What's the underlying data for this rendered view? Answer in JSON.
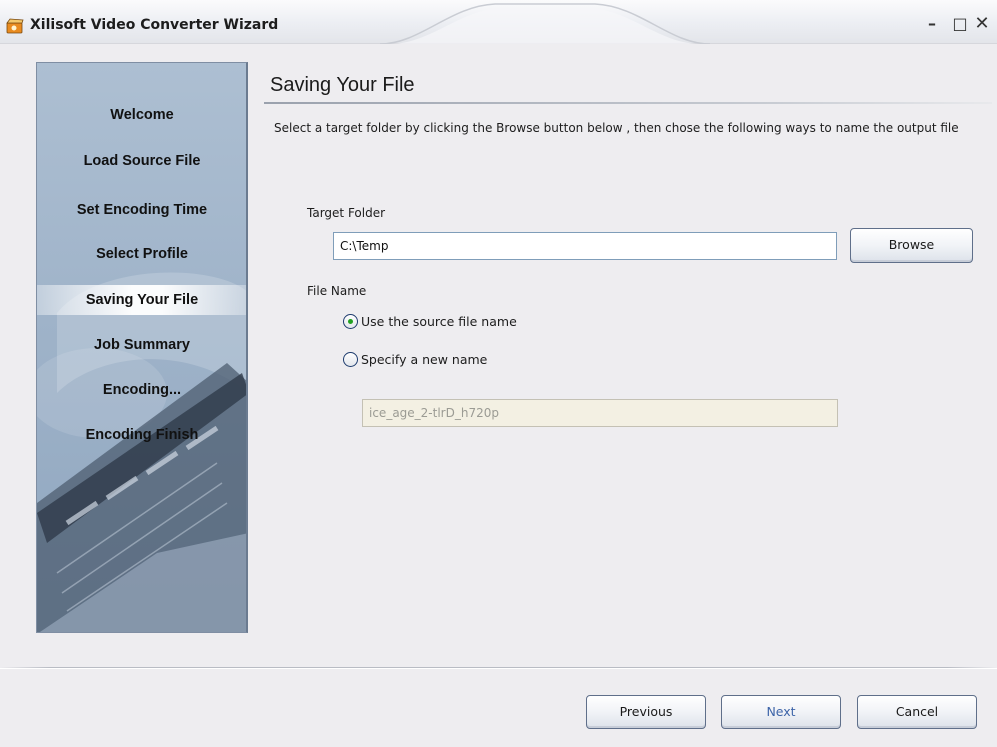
{
  "window": {
    "title": "Xilisoft Video Converter Wizard",
    "minimize_glyph": "–",
    "maximize_glyph": "□",
    "close_glyph": "✕"
  },
  "sidebar": {
    "steps": [
      {
        "label": "Welcome",
        "active": false
      },
      {
        "label": "Load Source File",
        "active": false
      },
      {
        "label": "Set Encoding Time",
        "active": false
      },
      {
        "label": "Select Profile",
        "active": false
      },
      {
        "label": "Saving Your File",
        "active": true
      },
      {
        "label": "Job Summary",
        "active": false
      },
      {
        "label": "Encoding...",
        "active": false
      },
      {
        "label": "Encoding Finish",
        "active": false
      }
    ]
  },
  "main": {
    "heading": "Saving Your File",
    "instructions": "Select a target folder by clicking the Browse button below , then chose the following ways to name the output file",
    "target_folder_label": "Target Folder",
    "target_folder_value": "C:\\Temp",
    "browse_label": "Browse",
    "file_name_label": "File Name",
    "option_source": "Use the source file name",
    "option_new": "Specify a new name",
    "new_name_value": "ice_age_2-tlrD_h720p",
    "selected_option": "source"
  },
  "footer": {
    "previous_label": "Previous",
    "next_label": "Next",
    "cancel_label": "Cancel"
  },
  "colors": {
    "accent": "#3d64a8",
    "radio_dot": "#21a121",
    "sidebar": "#9fb3c9"
  }
}
